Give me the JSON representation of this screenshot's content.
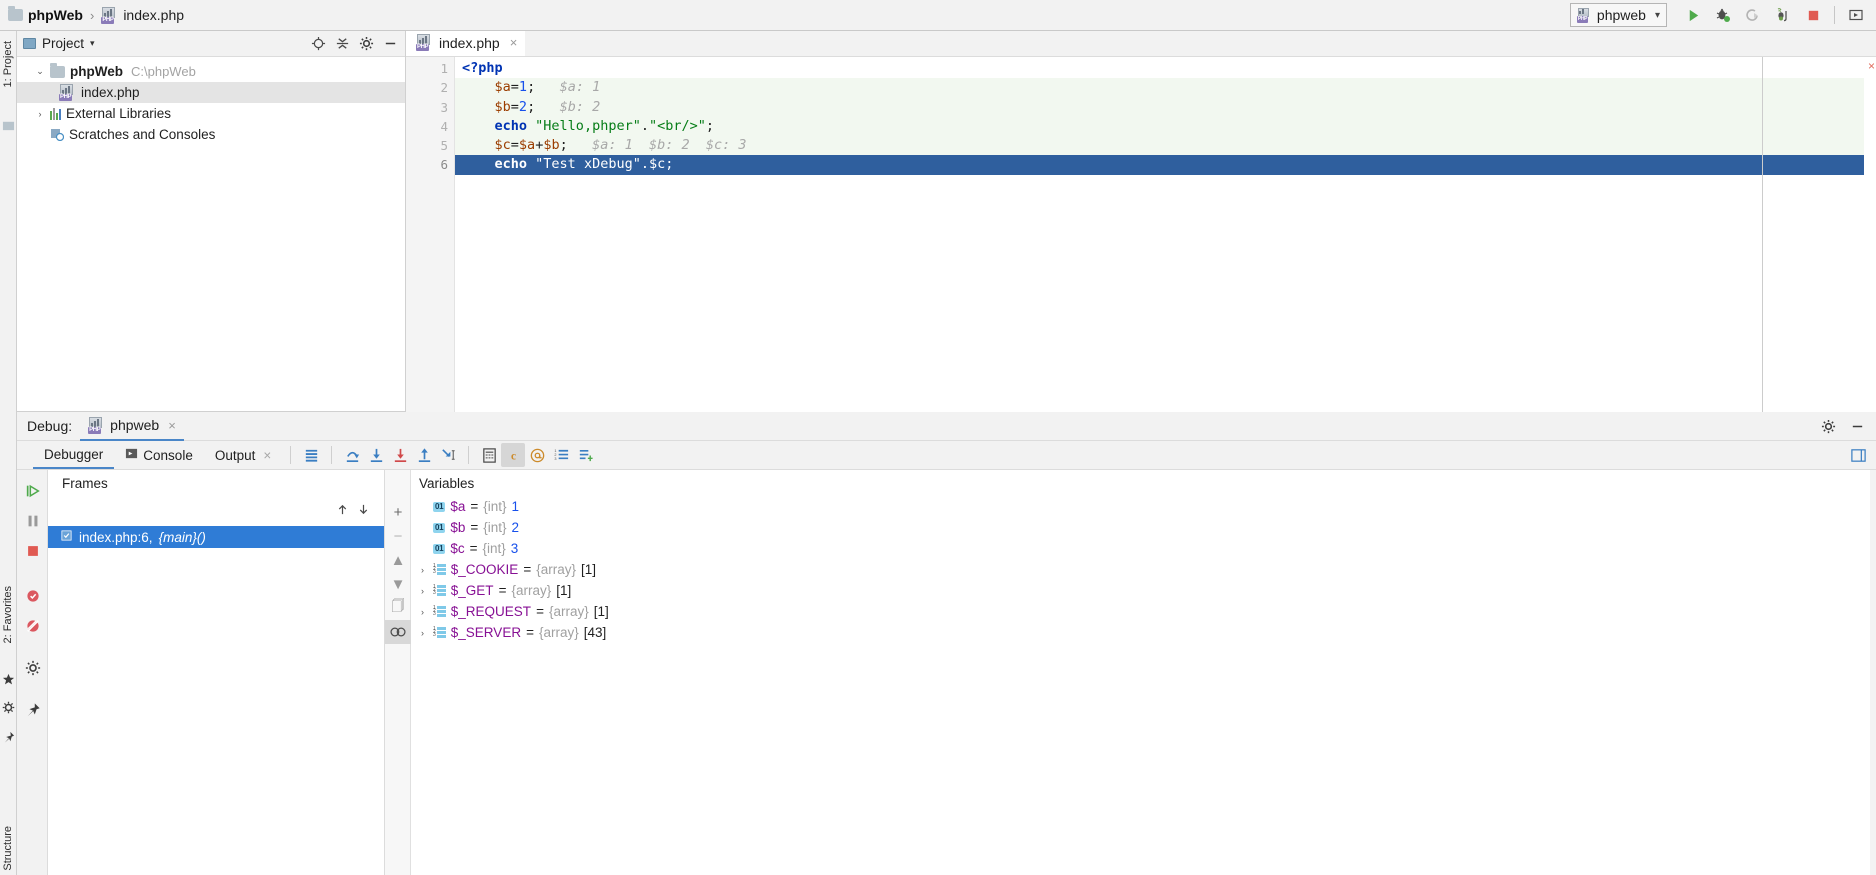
{
  "breadcrumb": {
    "project": "phpWeb",
    "separator": "›",
    "file": "index.php"
  },
  "toolbar": {
    "run_config": "phpweb",
    "run_config_chevron": "▾",
    "buttons": [
      {
        "name": "run-button",
        "icon": "play-icon",
        "color": "#4faa4c"
      },
      {
        "name": "debug-button",
        "icon": "bug-icon",
        "color": "#3d8b40"
      },
      {
        "name": "attach-debugger-button",
        "icon": "attach-icon",
        "color": "#9e9e9e"
      },
      {
        "name": "stop-listen-button",
        "icon": "phone-listen-icon",
        "color": "#6e9e4c"
      },
      {
        "name": "stop-button",
        "icon": "stop-square-icon",
        "color": "#e05a52"
      },
      {
        "name": "terminal-button",
        "icon": "console-icon",
        "color": "#4f4f4f"
      }
    ]
  },
  "left_rail": {
    "project_label": "1: Project",
    "favorites_label": "2: Favorites",
    "structure_label": "Structure",
    "icons": [
      "project-icon",
      "favorites-star-icon",
      "tool-icon",
      "settings-gear-icon",
      "pin-icon"
    ]
  },
  "project_panel": {
    "title": "Project",
    "caret": "▾",
    "header_icons": [
      "locate-target-icon",
      "collapse-all-icon",
      "settings-gear-icon",
      "hide-icon"
    ],
    "tree": [
      {
        "label": "phpWeb",
        "path": "C:\\phpWeb",
        "arrow": "⌄",
        "icon": "folder-icon",
        "bold": true,
        "selected": false,
        "indent": 0
      },
      {
        "label": "index.php",
        "path": "",
        "arrow": "",
        "icon": "php-file-icon",
        "bold": false,
        "selected": true,
        "indent": 1
      },
      {
        "label": "External Libraries",
        "path": "",
        "arrow": "›",
        "icon": "libraries-icon",
        "bold": false,
        "selected": false,
        "indent": 0
      },
      {
        "label": "Scratches and Consoles",
        "path": "",
        "arrow": "",
        "icon": "scratches-icon",
        "bold": false,
        "selected": false,
        "indent": 0
      }
    ]
  },
  "editor": {
    "tab": {
      "label": "index.php",
      "icon": "php-file-icon",
      "close": "×"
    },
    "error_marker": "×",
    "lines": [
      {
        "num": "1",
        "breakpoint": false,
        "highlighted": false,
        "hint_bg": false,
        "tokens": [
          {
            "t": "<?php",
            "c": "kw"
          }
        ]
      },
      {
        "num": "2",
        "breakpoint": false,
        "highlighted": false,
        "hint_bg": true,
        "tokens": [
          {
            "t": "    ",
            "c": "pun"
          },
          {
            "t": "$a",
            "c": "var2"
          },
          {
            "t": "=",
            "c": "pun"
          },
          {
            "t": "1",
            "c": "num"
          },
          {
            "t": ";",
            "c": "pun"
          },
          {
            "t": "   $a: 1",
            "c": "inlay"
          }
        ]
      },
      {
        "num": "3",
        "breakpoint": false,
        "highlighted": false,
        "hint_bg": true,
        "tokens": [
          {
            "t": "    ",
            "c": "pun"
          },
          {
            "t": "$b",
            "c": "var2"
          },
          {
            "t": "=",
            "c": "pun"
          },
          {
            "t": "2",
            "c": "num"
          },
          {
            "t": ";",
            "c": "pun"
          },
          {
            "t": "   $b: 2",
            "c": "inlay"
          }
        ]
      },
      {
        "num": "4",
        "breakpoint": false,
        "highlighted": false,
        "hint_bg": true,
        "tokens": [
          {
            "t": "    ",
            "c": "pun"
          },
          {
            "t": "echo",
            "c": "kw"
          },
          {
            "t": " ",
            "c": "pun"
          },
          {
            "t": "\"Hello,phper\"",
            "c": "str"
          },
          {
            "t": ".",
            "c": "pun"
          },
          {
            "t": "\"<br/>\"",
            "c": "str"
          },
          {
            "t": ";",
            "c": "pun"
          }
        ]
      },
      {
        "num": "5",
        "breakpoint": false,
        "highlighted": false,
        "hint_bg": true,
        "tokens": [
          {
            "t": "    ",
            "c": "pun"
          },
          {
            "t": "$c",
            "c": "var2"
          },
          {
            "t": "=",
            "c": "pun"
          },
          {
            "t": "$a",
            "c": "var2"
          },
          {
            "t": "+",
            "c": "pun"
          },
          {
            "t": "$b",
            "c": "var2"
          },
          {
            "t": ";",
            "c": "pun"
          },
          {
            "t": "   $a: 1  $b: 2  $c: 3",
            "c": "inlay"
          }
        ]
      },
      {
        "num": "6",
        "breakpoint": true,
        "highlighted": true,
        "hint_bg": false,
        "tokens": [
          {
            "t": "    ",
            "c": "pun"
          },
          {
            "t": "echo",
            "c": "kw"
          },
          {
            "t": " ",
            "c": "pun"
          },
          {
            "t": "\"Test xDebug\"",
            "c": "str"
          },
          {
            "t": ".",
            "c": "pun"
          },
          {
            "t": "$c",
            "c": "var"
          },
          {
            "t": ";",
            "c": "pun"
          }
        ]
      }
    ]
  },
  "debug": {
    "label": "Debug:",
    "session_tab": "phpweb",
    "session_close": "×",
    "header_icons": [
      "settings-gear-icon",
      "hide-icon"
    ],
    "tabs": [
      {
        "label": "Debugger",
        "icon": "",
        "active": true,
        "closable": false
      },
      {
        "label": "Console",
        "icon": "console-icon",
        "active": false,
        "closable": false
      },
      {
        "label": "Output",
        "icon": "",
        "active": false,
        "closable": true
      }
    ],
    "step_buttons": [
      {
        "name": "show-execution-point-button",
        "icon": "execution-point-icon"
      },
      {
        "name": "step-over-button",
        "icon": "step-over-icon"
      },
      {
        "name": "step-into-button",
        "icon": "step-into-icon"
      },
      {
        "name": "force-step-into-button",
        "icon": "force-step-into-icon"
      },
      {
        "name": "step-out-button",
        "icon": "step-out-icon"
      },
      {
        "name": "run-to-cursor-button",
        "icon": "run-to-cursor-icon"
      }
    ],
    "right_buttons": [
      {
        "name": "evaluate-expression-button",
        "icon": "calculator-icon",
        "active": false
      },
      {
        "name": "mute-breakpoints-button",
        "icon": "c-badge-icon",
        "active": true
      },
      {
        "name": "at-watch-button",
        "icon": "at-icon",
        "active": false
      },
      {
        "name": "variables-list-button",
        "icon": "list-icon",
        "active": false
      },
      {
        "name": "settings-layout-button",
        "icon": "layout-icon",
        "active": false
      }
    ],
    "session_buttons": [
      {
        "name": "resume-program-button",
        "icon": "resume-icon",
        "color": "#4faa4c"
      },
      {
        "name": "pause-program-button",
        "icon": "pause-icon",
        "color": "#9a9a9a"
      },
      {
        "name": "stop-session-button",
        "icon": "stop-icon",
        "color": "#e05a52"
      },
      {
        "name": "view-breakpoints-button",
        "icon": "breakpoint-icon",
        "color": "#db5860"
      },
      {
        "name": "mute-breakpoints-toggle",
        "icon": "muted-breakpoint-icon",
        "color": "#db5860"
      },
      {
        "name": "settings-button",
        "icon": "gear-icon",
        "color": "#5a5a5a"
      },
      {
        "name": "pin-tab-button",
        "icon": "pin-icon",
        "color": "#5a5a5a"
      }
    ],
    "frames": {
      "title": "Frames",
      "thread_icons": [
        "arrow-up-icon",
        "arrow-down-icon"
      ],
      "rows": [
        {
          "label": "index.php:6,",
          "suffix": "{main}()",
          "selected": true,
          "icon": "frame-icon"
        }
      ]
    },
    "variables": {
      "title": "Variables",
      "side_buttons": [
        "plus-icon",
        "minus-icon",
        "up-icon",
        "down-icon",
        "copy-icon",
        "watch-icon"
      ],
      "rows": [
        {
          "expand": "",
          "badge": "int",
          "badge_text": "01",
          "name": "$a",
          "eq": " = ",
          "type": "{int}",
          "value": "1",
          "count": ""
        },
        {
          "expand": "",
          "badge": "int",
          "badge_text": "01",
          "name": "$b",
          "eq": " = ",
          "type": "{int}",
          "value": "2",
          "count": ""
        },
        {
          "expand": "",
          "badge": "int",
          "badge_text": "01",
          "name": "$c",
          "eq": " = ",
          "type": "{int}",
          "value": "3",
          "count": ""
        },
        {
          "expand": "›",
          "badge": "array",
          "badge_text": "",
          "name": "$_COOKIE",
          "eq": " = ",
          "type": "{array}",
          "value": "",
          "count": "[1]"
        },
        {
          "expand": "›",
          "badge": "array",
          "badge_text": "",
          "name": "$_GET",
          "eq": " = ",
          "type": "{array}",
          "value": "",
          "count": "[1]"
        },
        {
          "expand": "›",
          "badge": "array",
          "badge_text": "",
          "name": "$_REQUEST",
          "eq": " = ",
          "type": "{array}",
          "value": "",
          "count": "[1]"
        },
        {
          "expand": "›",
          "badge": "array",
          "badge_text": "",
          "name": "$_SERVER",
          "eq": " = ",
          "type": "{array}",
          "value": "",
          "count": "[43]"
        }
      ]
    }
  },
  "colors": {
    "accent_blue": "#2f7cd6",
    "selection_blue": "#2f5f9e",
    "breakpoint_red": "#db5860",
    "run_green": "#4faa4c",
    "keyword_blue": "#0033b3",
    "string_green": "#067d17",
    "variable_purple": "#871094"
  }
}
